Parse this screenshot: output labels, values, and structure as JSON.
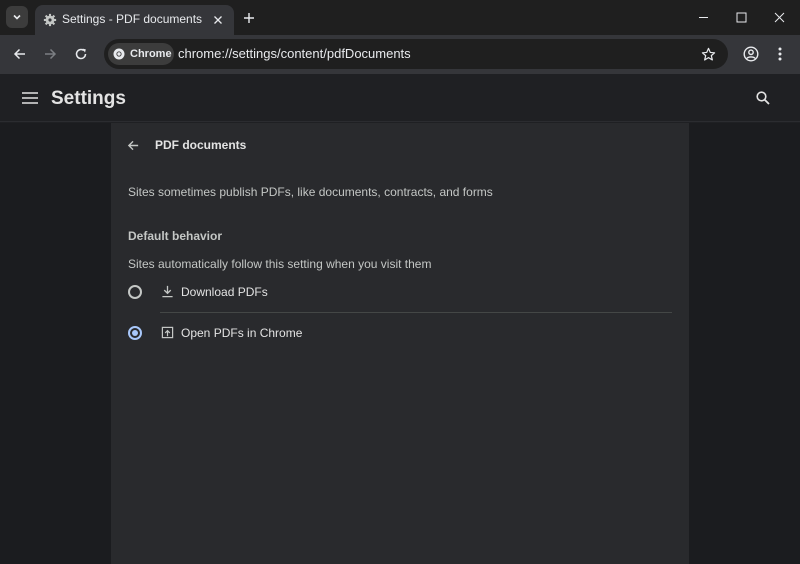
{
  "browser": {
    "tab": {
      "title": "Settings - PDF documents"
    },
    "omnibox": {
      "chip_label": "Chrome",
      "url": "chrome://settings/content/pdfDocuments"
    }
  },
  "settings": {
    "header_title": "Settings",
    "page": {
      "title": "PDF documents",
      "description": "Sites sometimes publish PDFs, like documents, contracts, and forms",
      "section_title": "Default behavior",
      "section_subtitle": "Sites automatically follow this setting when you visit them",
      "options": [
        {
          "label": "Download PDFs",
          "icon": "download-icon",
          "selected": false
        },
        {
          "label": "Open PDFs in Chrome",
          "icon": "open-in-new-icon",
          "selected": true
        }
      ]
    }
  },
  "colors": {
    "accent": "#a8c7fa",
    "card_bg": "#292a2d",
    "page_bg": "#1b1c1f"
  }
}
